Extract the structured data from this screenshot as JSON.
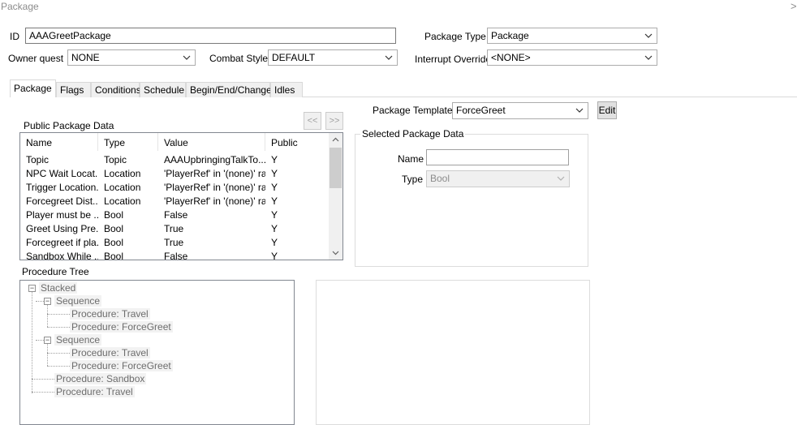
{
  "window": {
    "title": "Package",
    "close_glyph": ">"
  },
  "form": {
    "id_label": "ID",
    "id_value": "AAAGreetPackage",
    "package_type_label": "Package Type",
    "package_type_value": "Package",
    "owner_quest_label": "Owner quest",
    "owner_quest_value": "NONE",
    "combat_style_label": "Combat Style",
    "combat_style_value": "DEFAULT",
    "interrupt_override_label": "Interrupt Override",
    "interrupt_override_value": "<NONE>"
  },
  "tabs": [
    {
      "label": "Package",
      "active": true
    },
    {
      "label": "Flags"
    },
    {
      "label": "Conditions"
    },
    {
      "label": "Schedule"
    },
    {
      "label": "Begin/End/Change"
    },
    {
      "label": "Idles"
    }
  ],
  "public_data": {
    "title": "Public Package Data",
    "prev_label": "<<",
    "next_label": ">>",
    "columns": [
      "Name",
      "Type",
      "Value",
      "Public"
    ],
    "rows": [
      [
        "Topic",
        "Topic",
        "AAAUpbringingTalkTo...",
        "Y"
      ],
      [
        "NPC Wait Locat...",
        "Location",
        "'PlayerRef' in '(none)' ra...",
        "Y"
      ],
      [
        "Trigger Location...",
        "Location",
        "'PlayerRef' in '(none)' ra...",
        "Y"
      ],
      [
        "Forcegreet Dist...",
        "Location",
        "'PlayerRef' in '(none)' ra...",
        "Y"
      ],
      [
        "Player must be ...",
        "Bool",
        "False",
        "Y"
      ],
      [
        "Greet Using Pre...",
        "Bool",
        "True",
        "Y"
      ],
      [
        "Forcegreet if pla...",
        "Bool",
        "True",
        "Y"
      ],
      [
        "Sandbox While ...",
        "Bool",
        "False",
        "Y"
      ]
    ]
  },
  "template": {
    "label": "Package Template",
    "value": "ForceGreet",
    "edit_label": "Edit"
  },
  "selected": {
    "title": "Selected Package Data",
    "name_label": "Name",
    "name_value": "",
    "type_label": "Type",
    "type_value": "Bool"
  },
  "procedure_tree": {
    "title": "Procedure Tree",
    "nodes": [
      "Stacked",
      "Sequence",
      "Procedure: Travel",
      "Procedure: ForceGreet",
      "Sequence",
      "Procedure: Travel",
      "Procedure: ForceGreet",
      "Procedure: Sandbox",
      "Procedure: Travel"
    ]
  },
  "colors": {
    "tab_border": "#d9d9d9",
    "group_border": "#dcdcdc",
    "disabled_text": "#8c8c8c"
  }
}
